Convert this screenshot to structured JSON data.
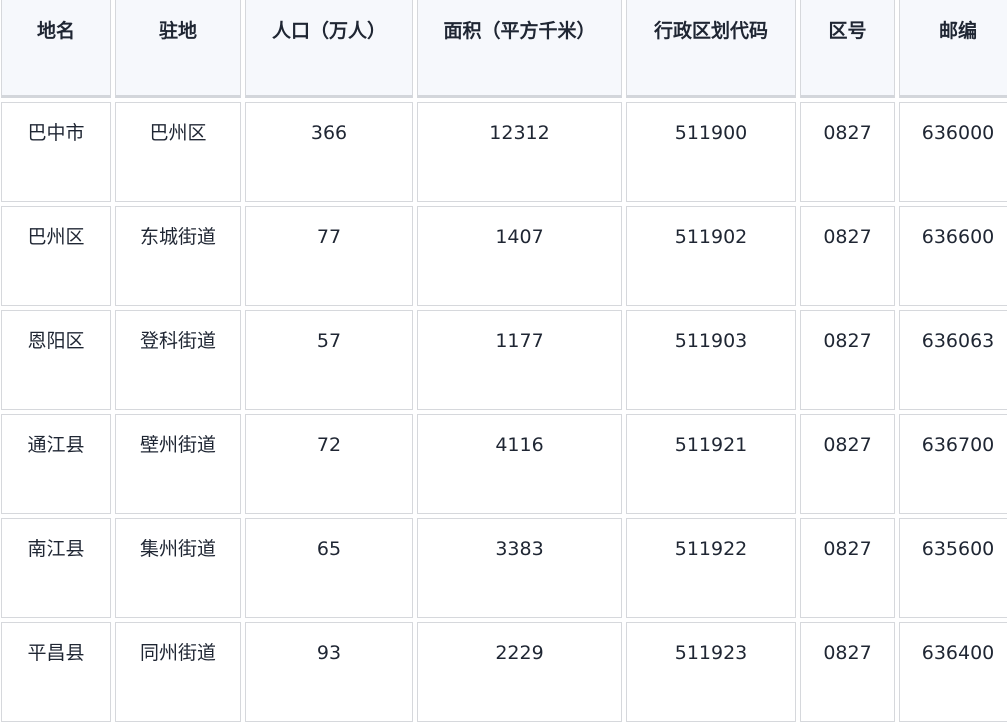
{
  "table": {
    "headers": [
      "地名",
      "驻地",
      "人口（万人）",
      "面积（平方千米）",
      "行政区划代码",
      "区号",
      "邮编"
    ],
    "rows": [
      [
        "巴中市",
        "巴州区",
        "366",
        "12312",
        "511900",
        "0827",
        "636000"
      ],
      [
        "巴州区",
        "东城街道",
        "77",
        "1407",
        "511902",
        "0827",
        "636600"
      ],
      [
        "恩阳区",
        "登科街道",
        "57",
        "1177",
        "511903",
        "0827",
        "636063"
      ],
      [
        "通江县",
        "壁州街道",
        "72",
        "4116",
        "511921",
        "0827",
        "636700"
      ],
      [
        "南江县",
        "集州街道",
        "65",
        "3383",
        "511922",
        "0827",
        "635600"
      ],
      [
        "平昌县",
        "同州街道",
        "93",
        "2229",
        "511923",
        "0827",
        "636400"
      ]
    ]
  }
}
